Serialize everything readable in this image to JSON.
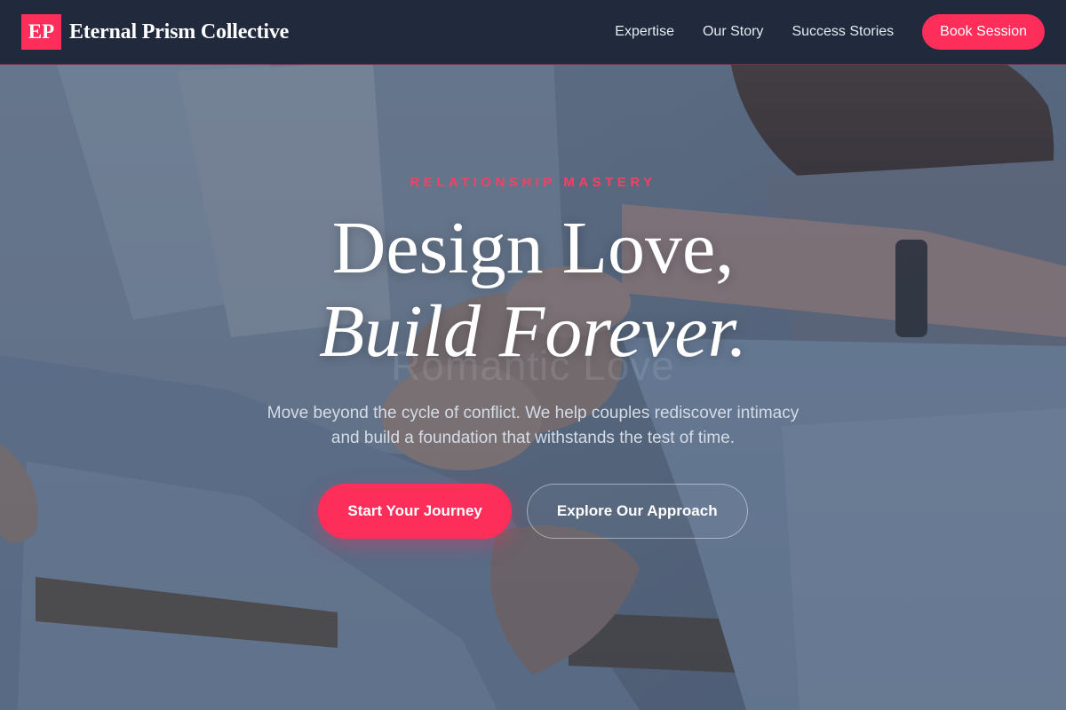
{
  "header": {
    "logo_mark": "EP",
    "brand_name": "Eternal Prism Collective",
    "nav": {
      "expertise": "Expertise",
      "our_story": "Our Story",
      "success_stories": "Success Stories"
    },
    "cta": "Book Session"
  },
  "hero": {
    "eyebrow": "RELATIONSHIP MASTERY",
    "headline_line1": "Design Love,",
    "headline_line2": "Build Forever.",
    "ghost_text": "Romantic Love",
    "subtext": "Move beyond the cycle of conflict. We help couples rediscover intimacy and build a foundation that withstands the test of time.",
    "primary_cta": "Start Your Journey",
    "secondary_cta": "Explore Our Approach"
  },
  "colors": {
    "accent": "#fe2e5a",
    "header_bg": "#202a3c",
    "text_light": "#d5dce6"
  }
}
